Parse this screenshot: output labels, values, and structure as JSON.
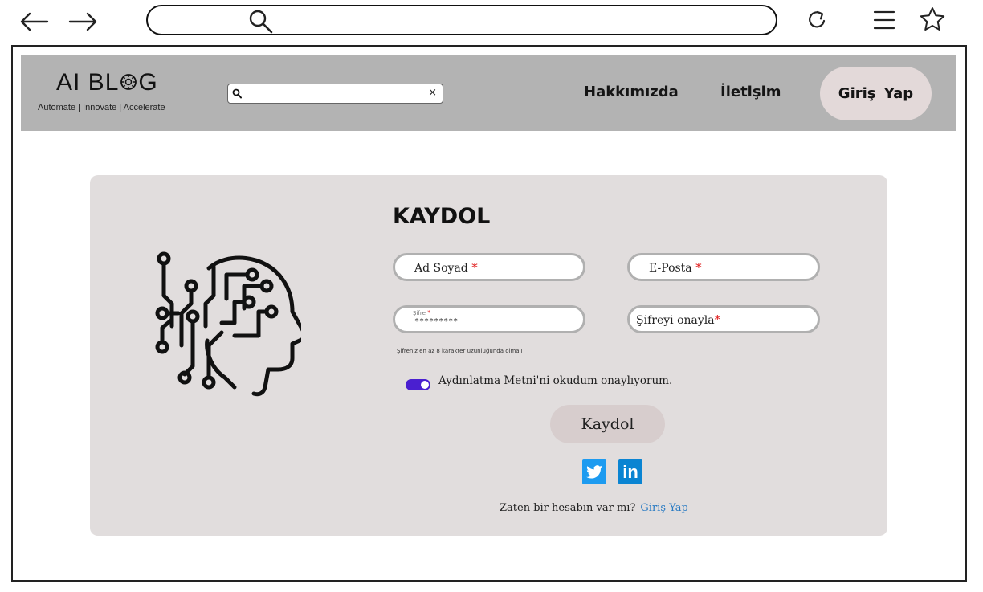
{
  "browser": {
    "icons": [
      "back-arrow-icon",
      "forward-arrow-icon",
      "search-icon",
      "reload-icon",
      "menu-icon",
      "star-icon"
    ]
  },
  "header": {
    "logo": "AI BL⚙G",
    "logo_text_prefix": "AI BL",
    "logo_text_suffix": "G",
    "tagline": "Automate | Innovate | Accelerate",
    "search_value": "",
    "search_clear": "×",
    "nav": {
      "about": "Hakkımızda",
      "contact": "İletişim",
      "login": "Giriş Yap"
    }
  },
  "form": {
    "title": "KAYDOL",
    "fields": {
      "full_name": {
        "label": "Ad Soyad",
        "required": "*"
      },
      "email": {
        "label": "E-Posta",
        "required": "*"
      },
      "password": {
        "label": "Şifre",
        "required": "*",
        "value": "*********"
      },
      "confirm_password": {
        "label": "Şifreyi onayla",
        "required": "*"
      }
    },
    "password_hint": "Şifreniz en az 8 karakter uzunluğunda olmalı",
    "consent": "Aydınlatma Metni'ni okudum onaylıyorum.",
    "consent_checked": true,
    "submit": "Kaydol",
    "social": {
      "linkedin": "in"
    },
    "have_account": "Zaten bir hesabın var mı?",
    "login_link": "Giriş Yap"
  },
  "colors": {
    "header_bg": "#b3b3b3",
    "card_bg": "#e1dddd",
    "toggle": "#4a1fd0",
    "link": "#2a7bc3",
    "required": "#e01b1b",
    "twitter": "#1d9bf0",
    "linkedin": "#0a84d2"
  }
}
